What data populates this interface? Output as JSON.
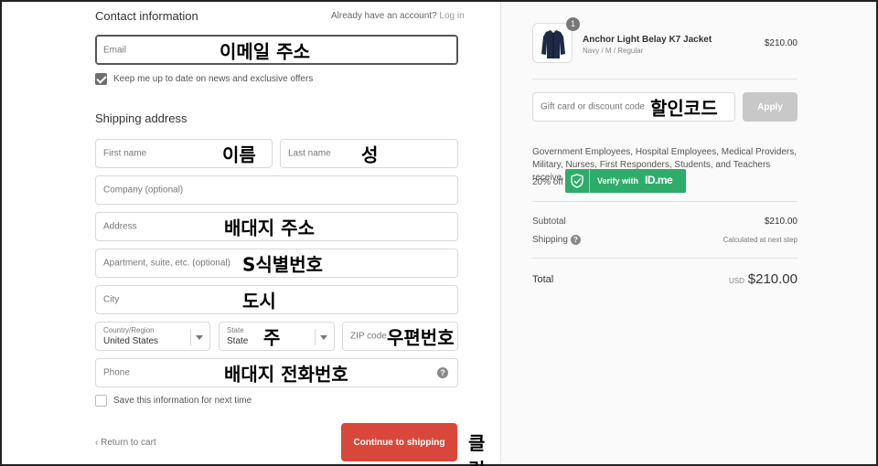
{
  "contact": {
    "title": "Contact information",
    "account_prompt": "Already have an account?",
    "login_link": "Log in",
    "email_placeholder": "Email",
    "email_annotation": "이메일 주소",
    "newsletter_label": "Keep me up to date on news and exclusive offers"
  },
  "shipping": {
    "title": "Shipping address",
    "first_name_placeholder": "First name",
    "first_name_annotation": "이름",
    "last_name_placeholder": "Last name",
    "last_name_annotation": "성",
    "company_placeholder": "Company (optional)",
    "address_placeholder": "Address",
    "address_annotation": "배대지 주소",
    "apartment_placeholder": "Apartment, suite, etc. (optional)",
    "apartment_annotation": "S식별번호",
    "city_placeholder": "City",
    "city_annotation": "도시",
    "country_label": "Country/Region",
    "country_value": "United States",
    "state_label": "State",
    "state_value": "State",
    "state_annotation": "주",
    "zip_placeholder": "ZIP code",
    "zip_annotation": "우편번호",
    "phone_placeholder": "Phone",
    "phone_annotation": "배대지 전화번호",
    "save_info_label": "Save this information for next time"
  },
  "footer": {
    "return_label": "Return to cart",
    "continue_label": "Continue to shipping",
    "click_annotation": "클릭"
  },
  "summary": {
    "item": {
      "quantity": "1",
      "name": "Anchor Light Belay K7 Jacket",
      "variant": "Navy / M / Regular",
      "price": "$210.00"
    },
    "discount_placeholder": "Gift card or discount code",
    "discount_annotation": "할인코드",
    "apply_label": "Apply",
    "idme_text": "Government Employees, Hospital Employees, Medical Providers, Military, Nurses, First Responders, Students, and Teachers receive",
    "idme_discount": "20% off",
    "idme_button_prefix": "Verify with",
    "idme_button_brand": "ID.me",
    "subtotal_label": "Subtotal",
    "subtotal_value": "$210.00",
    "shipping_label": "Shipping",
    "shipping_value": "Calculated at next step",
    "total_label": "Total",
    "currency": "USD",
    "total_value": "$210.00"
  },
  "colors": {
    "primary_button": "#d9473a",
    "idme_green": "#2eac6a",
    "apply_disabled": "#c8c8c8"
  }
}
